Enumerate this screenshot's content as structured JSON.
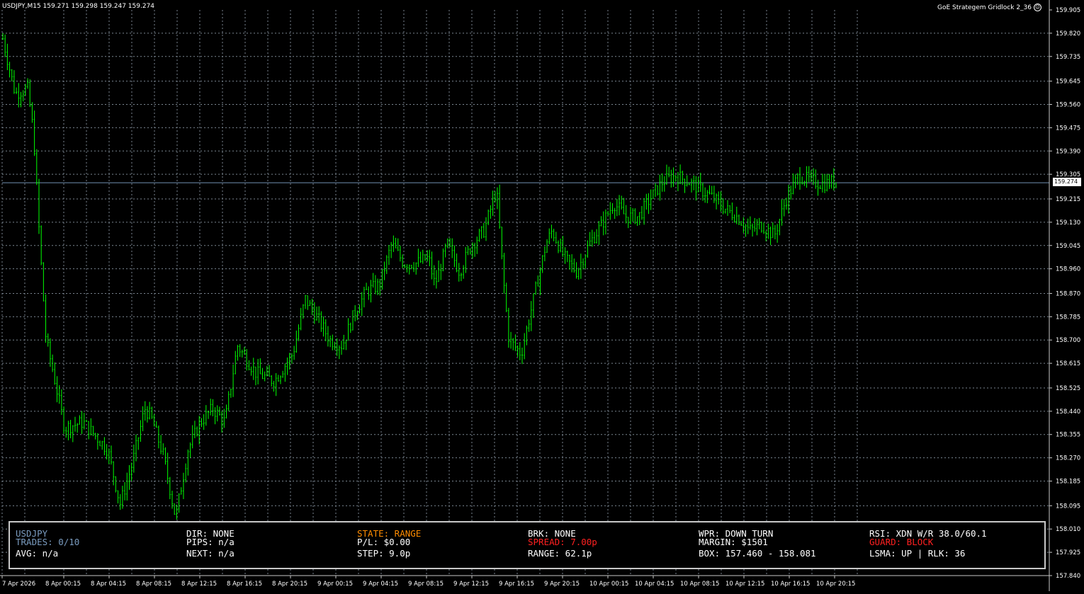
{
  "header": {
    "symbol_line": "USDJPY,M15  159.271 159.298 159.247 159.274",
    "ea_name": "GoE Strategem Gridlock 2_36"
  },
  "current_price": "159.274",
  "price_axis": [
    "159.905",
    "159.820",
    "159.735",
    "159.645",
    "159.560",
    "159.475",
    "159.390",
    "159.305",
    "159.215",
    "159.130",
    "159.045",
    "158.960",
    "158.870",
    "158.785",
    "158.700",
    "158.615",
    "158.525",
    "158.440",
    "158.355",
    "158.270",
    "158.185",
    "158.095",
    "158.010",
    "157.925",
    "157.840"
  ],
  "time_axis": [
    "7 Apr 2026",
    "8 Apr 00:15",
    "8 Apr 04:15",
    "8 Apr 08:15",
    "8 Apr 12:15",
    "8 Apr 16:15",
    "8 Apr 20:15",
    "9 Apr 00:15",
    "9 Apr 04:15",
    "9 Apr 08:15",
    "9 Apr 12:15",
    "9 Apr 16:15",
    "9 Apr 20:15",
    "10 Apr 00:15",
    "10 Apr 04:15",
    "10 Apr 08:15",
    "10 Apr 12:15",
    "10 Apr 16:15",
    "10 Apr 20:15"
  ],
  "colors": {
    "candle": "#00ff00",
    "grid": "#7a8590",
    "panel_border": "#c8c8c8",
    "text_white": "#ffffff",
    "text_orange": "#ff8c00",
    "text_red": "#ff2020",
    "text_steel": "#7a9cc0"
  },
  "panel": {
    "col1": [
      "USDJPY",
      "TRADES: 0/10",
      "AVG: n/a"
    ],
    "col2": [
      "DIR: NONE",
      "PIPS: n/a",
      "NEXT: n/a"
    ],
    "col3": [
      "STATE: RANGE",
      "P/L: $0.00",
      "STEP: 9.0p"
    ],
    "col4": [
      "BRK: NONE",
      "SPREAD: 7.00p",
      "RANGE: 62.1p"
    ],
    "col5": [
      "WPR: DOWN TURN",
      "MARGIN: $1501",
      "BOX: 157.460 - 158.081"
    ],
    "col6": [
      "RSI: XDN W/R 38.0/60.1",
      "GUARD: BLOCK",
      "LSMA: UP | RLK: 36"
    ]
  },
  "chart_data": {
    "type": "candlestick",
    "symbol": "USDJPY",
    "timeframe": "M15",
    "ylim": [
      157.84,
      159.905
    ],
    "last_price": 159.274,
    "close_path": [
      [
        0,
        159.8
      ],
      [
        2,
        159.6
      ],
      [
        4,
        159.62
      ],
      [
        5,
        159.45
      ],
      [
        6,
        159.05
      ],
      [
        7,
        158.7
      ],
      [
        8,
        158.6
      ],
      [
        10,
        158.38
      ],
      [
        13,
        158.4
      ],
      [
        17,
        158.3
      ],
      [
        19,
        158.1
      ],
      [
        21,
        158.25
      ],
      [
        23,
        158.45
      ],
      [
        24,
        158.42
      ],
      [
        26,
        158.28
      ],
      [
        28,
        158.05
      ],
      [
        30,
        158.3
      ],
      [
        32,
        158.4
      ],
      [
        34,
        158.45
      ],
      [
        36,
        158.4
      ],
      [
        38,
        158.68
      ],
      [
        41,
        158.58
      ],
      [
        44,
        158.55
      ],
      [
        47,
        158.65
      ],
      [
        49,
        158.85
      ],
      [
        51,
        158.78
      ],
      [
        53,
        158.7
      ],
      [
        55,
        158.68
      ],
      [
        57,
        158.8
      ],
      [
        59,
        158.88
      ],
      [
        61,
        158.9
      ],
      [
        63,
        159.05
      ],
      [
        65,
        158.98
      ],
      [
        67,
        158.98
      ],
      [
        69,
        159.0
      ],
      [
        70,
        158.9
      ],
      [
        72,
        159.05
      ],
      [
        74,
        158.95
      ],
      [
        76,
        159.05
      ],
      [
        78,
        159.1
      ],
      [
        80,
        159.25
      ],
      [
        81,
        158.95
      ],
      [
        82,
        158.7
      ],
      [
        84,
        158.65
      ],
      [
        86,
        158.85
      ],
      [
        88,
        159.05
      ],
      [
        89,
        159.1
      ],
      [
        91,
        159.0
      ],
      [
        93,
        158.95
      ],
      [
        95,
        159.05
      ],
      [
        97,
        159.12
      ],
      [
        99,
        159.2
      ],
      [
        101,
        159.15
      ],
      [
        103,
        159.15
      ],
      [
        105,
        159.22
      ],
      [
        107,
        159.28
      ],
      [
        109,
        159.3
      ],
      [
        111,
        159.28
      ],
      [
        113,
        159.25
      ],
      [
        115,
        159.22
      ],
      [
        117,
        159.18
      ],
      [
        119,
        159.15
      ],
      [
        121,
        159.1
      ],
      [
        123,
        159.12
      ],
      [
        125,
        159.08
      ],
      [
        127,
        159.22
      ],
      [
        129,
        159.3
      ],
      [
        131,
        159.28
      ],
      [
        133,
        159.27
      ],
      [
        135,
        159.28
      ]
    ]
  }
}
